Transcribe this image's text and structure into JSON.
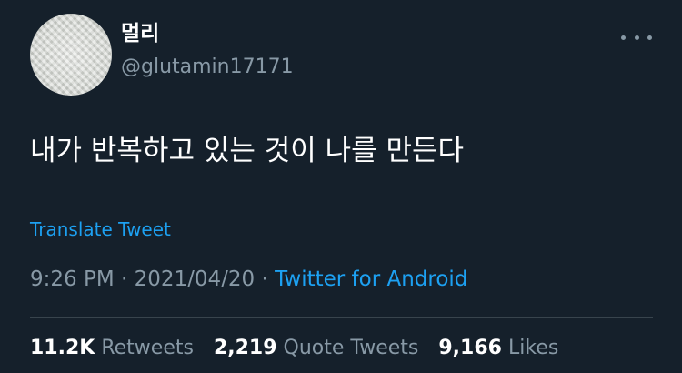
{
  "user": {
    "display_name": "멀리",
    "handle": "@glutamin17171"
  },
  "tweet": {
    "text": "내가 반복하고 있는 것이 나를 만든다",
    "translate_label": "Translate Tweet"
  },
  "meta": {
    "time": "9:26 PM",
    "separator": "·",
    "date": "2021/04/20",
    "source": "Twitter for Android"
  },
  "stats": {
    "retweets_count": "11.2K",
    "retweets_label": "Retweets",
    "quote_count": "2,219",
    "quote_label": "Quote Tweets",
    "likes_count": "9,166",
    "likes_label": "Likes"
  },
  "icons": {
    "more": "more-horizontal-icon"
  },
  "colors": {
    "background": "#15202b",
    "accent": "#1da1f2",
    "secondary_text": "#8899a6",
    "divider": "#38444d"
  }
}
